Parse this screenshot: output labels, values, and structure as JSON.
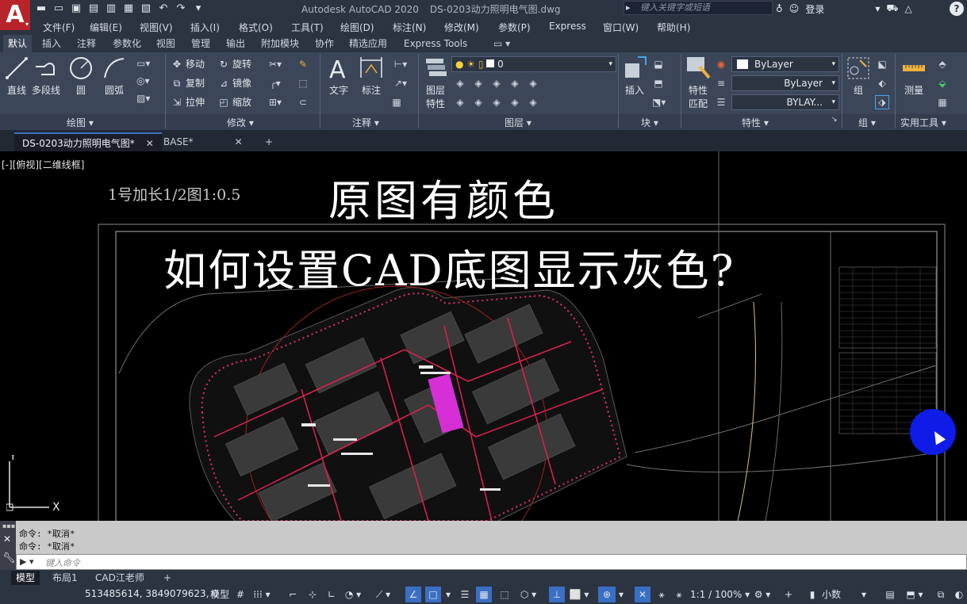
{
  "app": {
    "logo_letter": "A",
    "title": "Autodesk AutoCAD 2020",
    "filename": "DS-0203动力照明电气图.dwg",
    "search_placeholder": "键入关键字或短语",
    "login_label": "登录",
    "help_label": "?"
  },
  "menu": [
    "文件(F)",
    "编辑(E)",
    "视图(V)",
    "插入(I)",
    "格式(O)",
    "工具(T)",
    "绘图(D)",
    "标注(N)",
    "修改(M)",
    "参数(P)",
    "Express",
    "窗口(W)",
    "帮助(H)"
  ],
  "ribbon_tabs": [
    "默认",
    "插入",
    "注释",
    "参数化",
    "视图",
    "管理",
    "输出",
    "附加模块",
    "协作",
    "精选应用",
    "Express Tools"
  ],
  "ribbon": {
    "draw": {
      "line": "直线",
      "polyline": "多段线",
      "circle": "圆",
      "arc": "圆弧",
      "panel": "绘图 ▾"
    },
    "modify": {
      "move": "移动",
      "rotate": "旋转",
      "copy": "复制",
      "mirror": "镜像",
      "stretch": "拉伸",
      "scale": "缩放",
      "panel": "修改 ▾"
    },
    "annotation": {
      "text": "文字",
      "dimension": "标注",
      "panel": "注释 ▾"
    },
    "layers": {
      "properties_line1": "图层",
      "properties_line2": "特性",
      "current_layer": "0",
      "panel": "图层 ▾"
    },
    "block": {
      "insert": "插入",
      "panel": "块 ▾"
    },
    "properties": {
      "match_line1": "特性",
      "match_line2": "匹配",
      "color": "ByLayer",
      "linetype": "ByLayer",
      "lineweight": "BYLAY...",
      "panel": "特性 ▾"
    },
    "groups": {
      "group": "组",
      "panel": "组 ▾"
    },
    "utilities": {
      "measure": "测量",
      "panel": "实用工具 ▾"
    }
  },
  "file_tabs": [
    "DS-0203动力照明电气图*",
    "BASE*"
  ],
  "viewport": {
    "view_label": "[-][俯视][二维线框]",
    "sheet_label": "1号加长1/2图1:0.5",
    "overlay_line1": "原图有颜色",
    "overlay_line2": "如何设置CAD底图显示灰色?",
    "axis_x": "X",
    "axis_y": "Y"
  },
  "command": {
    "history": [
      "命令: *取消*",
      "命令: *取消*"
    ],
    "prompt": "▶ ▾",
    "placeholder": "键入命令"
  },
  "layout_tabs": [
    "模型",
    "布局1",
    "CAD江老师"
  ],
  "status": {
    "coordinates": "513485614, 3849079623, 0",
    "model_label": "模型",
    "annotation_scale": "1:1 / 100%",
    "units": "小数"
  }
}
